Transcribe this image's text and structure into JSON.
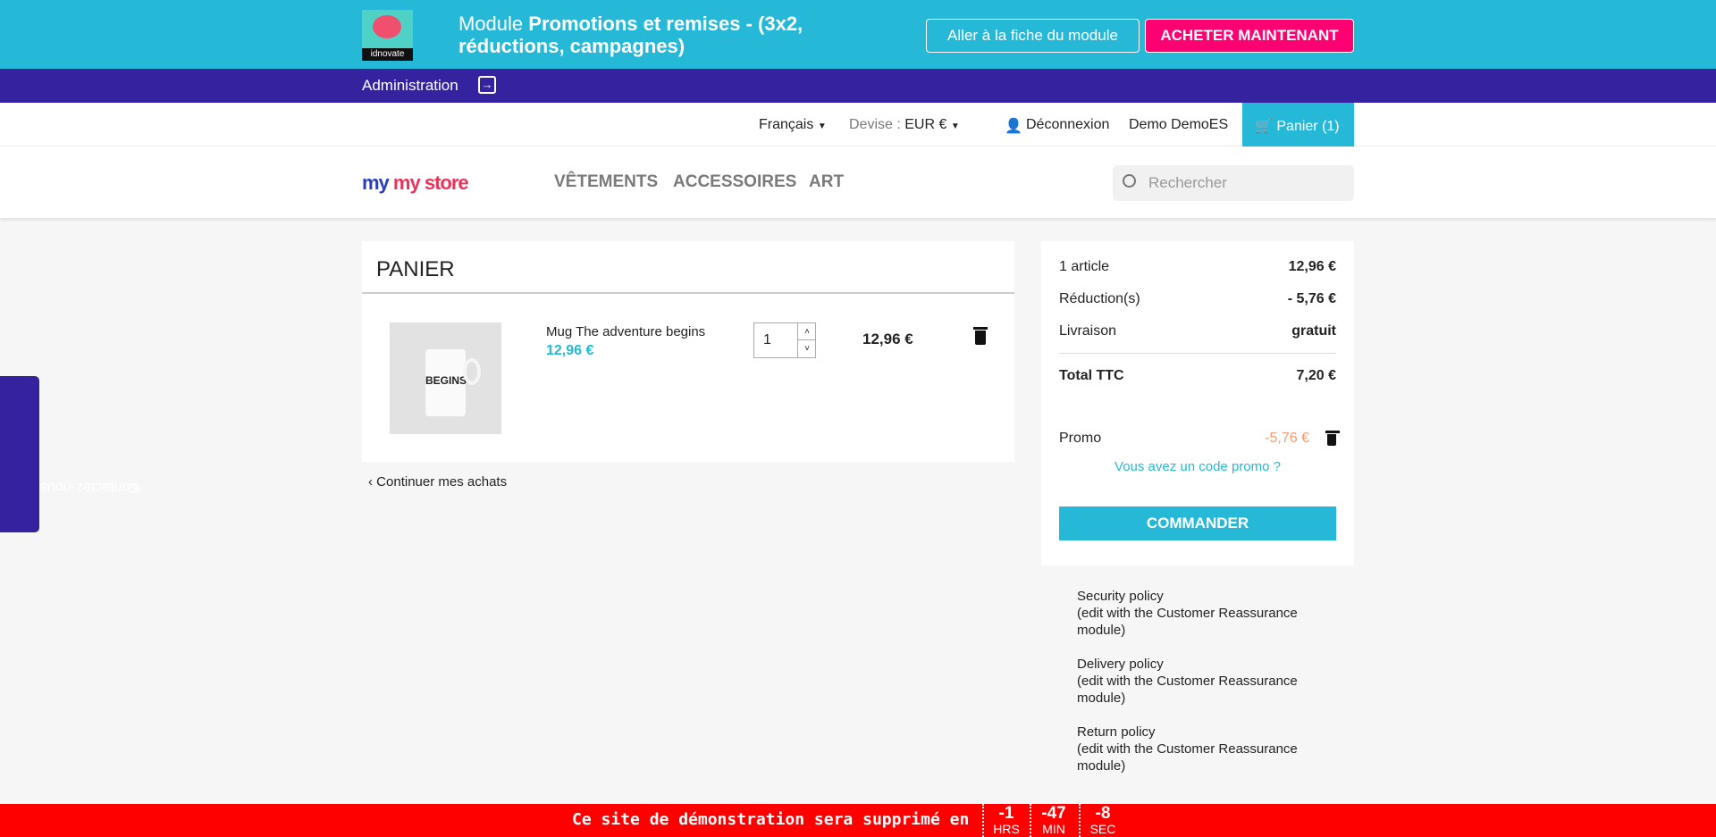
{
  "banner": {
    "logo_text": "idnovate",
    "title_prefix": "Module ",
    "title_bold": "Promotions et remises - (3x2, réductions, campagnes)",
    "module_button": "Aller à la fiche du module",
    "buy_button": "ACHETER MAINTENANT"
  },
  "admin": {
    "label": "Administration"
  },
  "topnav": {
    "language": "Français",
    "currency_label": "Devise :",
    "currency": "EUR €",
    "logout": "Déconnexion",
    "customer": "Demo DemoES",
    "cart": "Panier (1)"
  },
  "header": {
    "logo": "my store",
    "menu": [
      "VÊTEMENTS",
      "ACCESSOIRES",
      "ART"
    ],
    "search_placeholder": "Rechercher"
  },
  "cart": {
    "title": "PANIER",
    "item": {
      "name": "Mug The adventure begins",
      "price": "12,96 €",
      "quantity": "1",
      "total": "12,96 €",
      "image_text": "BEGINS"
    },
    "continue": "Continuer mes achats"
  },
  "summary": {
    "rows": [
      {
        "label": "1 article",
        "value": "12,96 €"
      },
      {
        "label": "Réduction(s)",
        "value": "- 5,76 €"
      },
      {
        "label": "Livraison",
        "value": "gratuit"
      }
    ],
    "total_label": "Total TTC",
    "total_value": "7,20 €",
    "promo_label": "Promo",
    "promo_value": "-5,76 €",
    "promo_link": "Vous avez un code promo ?",
    "order_button": "COMMANDER"
  },
  "reassurance": [
    {
      "title": "Security policy",
      "note": "(edit with the Customer Reassurance module)"
    },
    {
      "title": "Delivery policy",
      "note": "(edit with the Customer Reassurance module)"
    },
    {
      "title": "Return policy",
      "note": "(edit with the Customer Reassurance module)"
    }
  ],
  "contact_tab": "Contactez-nous",
  "demo_bar": {
    "message": "Ce site de démonstration sera supprimé en",
    "countdown": [
      {
        "value": "-1",
        "unit": "HRS"
      },
      {
        "value": "-47",
        "unit": "MIN"
      },
      {
        "value": "-8",
        "unit": "SEC"
      }
    ]
  },
  "colors": {
    "accent": "#25b9d7",
    "admin": "#35229e",
    "buy": "#ff0073",
    "promo": "#f39d72",
    "demo_bar": "#ff0000"
  }
}
